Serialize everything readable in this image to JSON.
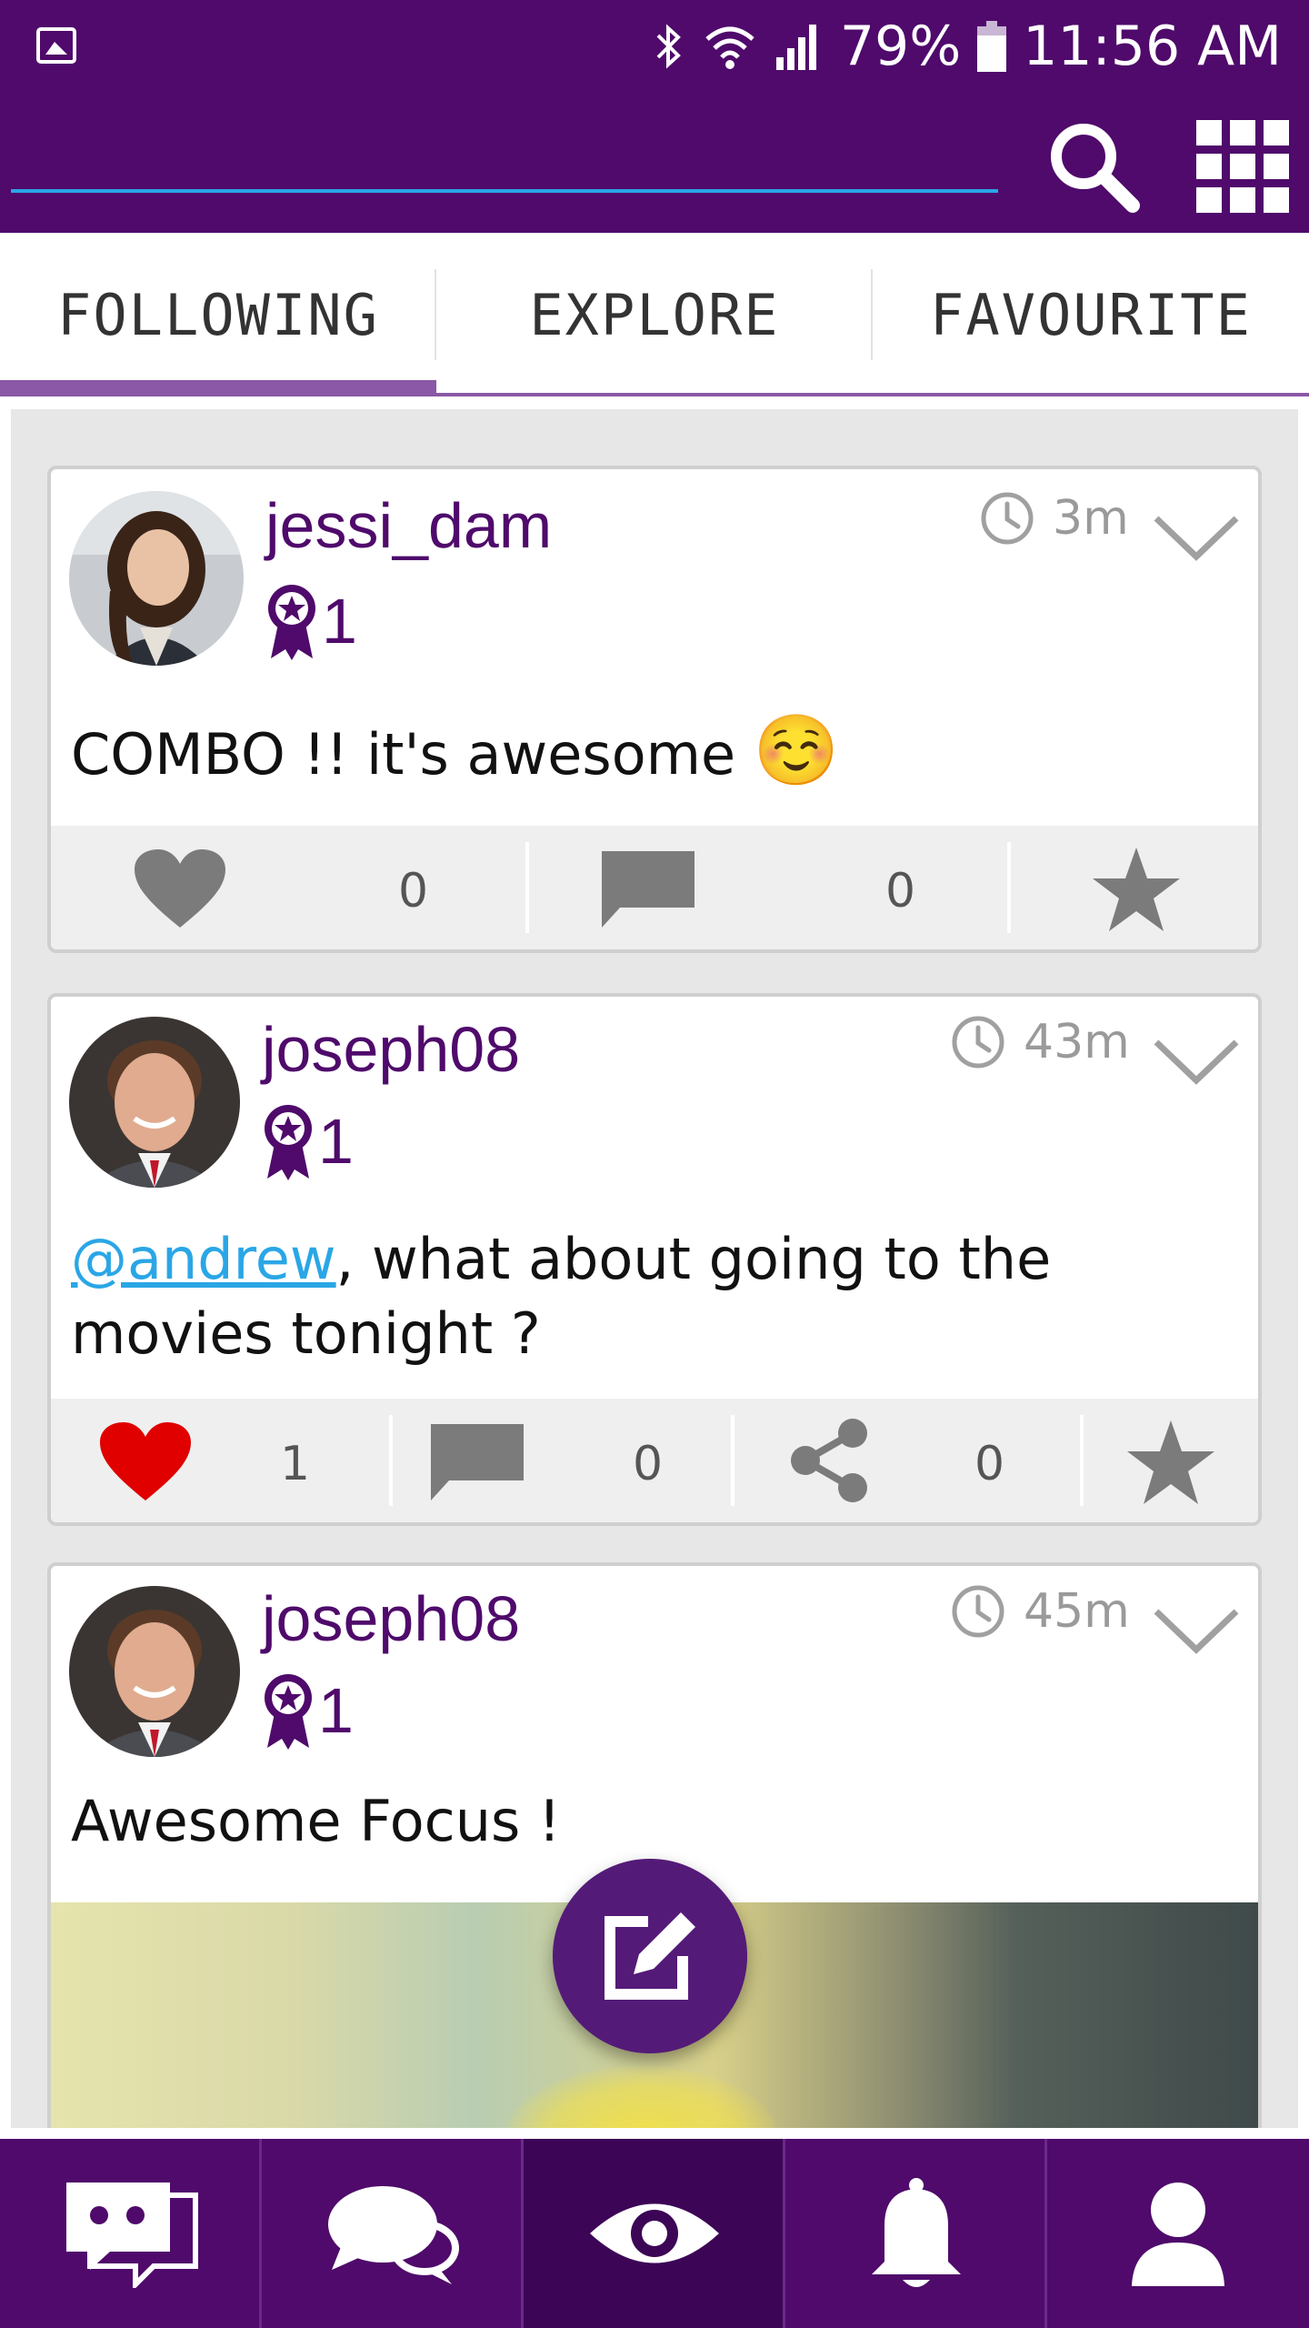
{
  "status_bar": {
    "battery": "79%",
    "time": "11:56 AM",
    "icons": [
      "gallery-icon",
      "bluetooth-icon",
      "wifi-icon",
      "signal-icon",
      "battery-icon"
    ]
  },
  "search": {
    "value": "",
    "placeholder": ""
  },
  "tabs": [
    {
      "label": "FOLLOWING",
      "active": true
    },
    {
      "label": "EXPLORE",
      "active": false
    },
    {
      "label": "FAVOURITE",
      "active": false
    }
  ],
  "posts": [
    {
      "username": "jessi_dam",
      "badge_count": "1",
      "time": "3m",
      "text": "COMBO !! it's awesome",
      "emoji": "☺️",
      "likes": "0",
      "comments": "0",
      "liked": false
    },
    {
      "username": "joseph08",
      "badge_count": "1",
      "time": "43m",
      "mention": "@andrew",
      "text_line1": ", what about going to the",
      "text_line2": "movies tonight ?",
      "likes": "1",
      "comments": "0",
      "shares": "0",
      "liked": true
    },
    {
      "username": "joseph08",
      "badge_count": "1",
      "time": "45m",
      "text": "Awesome Focus !"
    }
  ],
  "colors": {
    "primary": "#4f0a6b",
    "accent_underline": "#2aa6e6",
    "tab_indicator": "#8a58a6",
    "like_red": "#e00000",
    "icon_gray": "#7b7b7b"
  },
  "bottom_nav": [
    {
      "icon": "messenger-icon",
      "active": false
    },
    {
      "icon": "chat-bubbles-icon",
      "active": false
    },
    {
      "icon": "eye-icon",
      "active": true
    },
    {
      "icon": "bell-icon",
      "active": false
    },
    {
      "icon": "profile-icon",
      "active": false
    }
  ]
}
